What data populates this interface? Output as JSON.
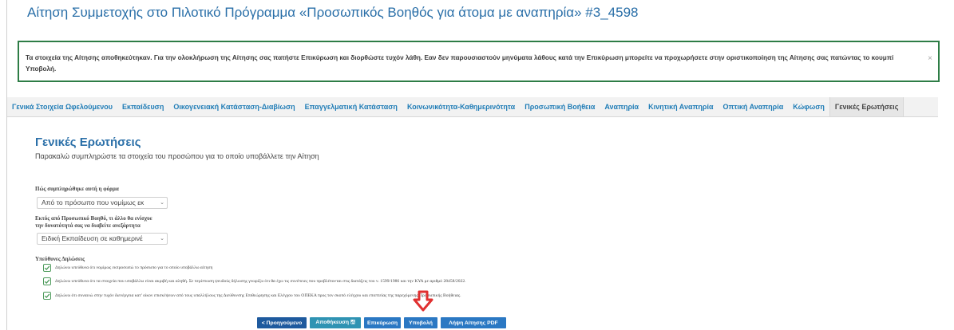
{
  "page": {
    "title": "Αίτηση Συμμετοχής στο Πιλοτικό Πρόγραμμα «Προσωπικός Βοηθός για άτομα με αναπηρία» #3_4598"
  },
  "alert": {
    "message": "Τα στοιχεία της Αίτησης αποθηκεύτηκαν. Για την ολοκλήρωση της Αίτησης σας πατήστε Επικύρωση και διορθώστε τυχόν λάθη. Εαν δεν παρουσιαστούν μηνύματα λάθους κατά την Επικύρωση μπορείτε να προχωρήσετε στην οριστικοποίηση της Αίτησης σας πατώντας το κουμπί Υποβολή.",
    "close": "×"
  },
  "tabs": [
    {
      "label": "Γενικά Στοιχεία Ωφελούμενου"
    },
    {
      "label": "Εκπαίδευση"
    },
    {
      "label": "Οικογενειακή Κατάσταση-Διαβίωση"
    },
    {
      "label": "Επαγγελματική Κατάσταση"
    },
    {
      "label": "Κοινωνικότητα-Καθημερινότητα"
    },
    {
      "label": "Προσωπική Βοήθεια"
    },
    {
      "label": "Αναπηρία"
    },
    {
      "label": "Κινητική Αναπηρία"
    },
    {
      "label": "Οπτική Αναπηρία"
    },
    {
      "label": "Κώφωση"
    },
    {
      "label": "Γενικές Ερωτήσεις",
      "active": true
    }
  ],
  "section": {
    "title": "Γενικές Ερωτήσεις",
    "subtitle": "Παρακαλώ συμπληρώστε τα στοιχεία του προσώπου για το οποίο υποβάλλετε την Αίτηση"
  },
  "form": {
    "q1_label": "Πώς συμπληρώθηκε αυτή η φόρμα",
    "q1_value": "Από το πρόσωπο που νομίμως εκ",
    "q2_label_line1": "Εκτός από Προσωπικό Βοηθό, τι άλλο θα ενίσχυε",
    "q2_label_line2": "την δυνατότητά σας να διαβείτε ανεξάρτητα",
    "q2_value": "Ειδική Εκπαίδευση σε καθημερινέ",
    "chevron": "⌄"
  },
  "declarations": {
    "heading": "Υπεύθυνες Δηλώσεις",
    "items": [
      {
        "text": "Δηλώνω υπεύθυνα ότι νομίμως εκπροσωπώ το πρόσωπο για το οποίο υποβάλλω αίτηση",
        "checked": true
      },
      {
        "text": "Δηλώνω υπεύθυνα ότι τα στοιχεία που υποβάλλω είναι ακριβή και αληθή. Σε περίπτωση ψευδούς δήλωσης γνωρίζω ότι θα έχω τις συνέπειες που προβλέπονται στις διατάξεις του ν. 1599/1986 και την ΚΥΑ με αριθμό 28458/2022.",
        "checked": true
      },
      {
        "text": "Δηλώνω ότι συναινώ στην τυχόν διενέργεια κατ' οίκον επισκέψεων από τους υπαλλήλους της Διεύθυνσης Επιθεώρησης και Ελέγχου του ΟΠΕΚΑ προς τον σκοπό ελέγχου και εποπτείας της παρεχόμενης Προσωπικής Βοήθειας.",
        "checked": true
      }
    ]
  },
  "buttons": {
    "previous": "< Προηγούμενο",
    "save": "Αποθήκευση 🖫",
    "validate": "Επικύρωση",
    "submit": "Υποβολή",
    "download_pdf": "Λήψη Αίτησης PDF"
  },
  "colors": {
    "title_blue": "#2a6fa8",
    "alert_border": "#2e7d46",
    "tab_link": "#1f7cb6",
    "arrow_red": "#e03030"
  }
}
